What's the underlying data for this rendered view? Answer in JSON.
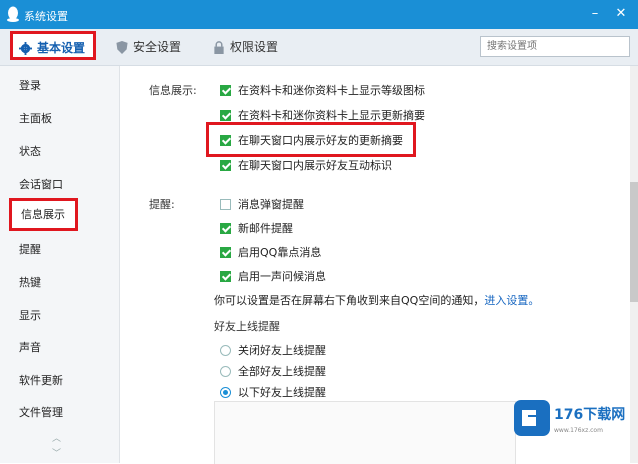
{
  "window": {
    "title": "系统设置",
    "minimize": "–",
    "close": "✕"
  },
  "tabs": [
    {
      "label": "基本设置",
      "icon": "gear-icon",
      "active": true
    },
    {
      "label": "安全设置",
      "icon": "shield-icon",
      "active": false
    },
    {
      "label": "权限设置",
      "icon": "lock-icon",
      "active": false
    }
  ],
  "search": {
    "placeholder": "搜索设置项"
  },
  "sidebar": {
    "items": [
      {
        "label": "登录"
      },
      {
        "label": "主面板"
      },
      {
        "label": "状态"
      },
      {
        "label": "会话窗口"
      },
      {
        "label": "信息展示",
        "active": true
      },
      {
        "label": "提醒"
      },
      {
        "label": "热键"
      },
      {
        "label": "显示"
      },
      {
        "label": "声音"
      },
      {
        "label": "软件更新"
      },
      {
        "label": "文件管理"
      }
    ]
  },
  "info_display": {
    "label": "信息展示:",
    "options": [
      {
        "label": "在资料卡和迷你资料卡上显示等级图标",
        "checked": true
      },
      {
        "label": "在资料卡和迷你资料卡上显示更新摘要",
        "checked": true
      },
      {
        "label": "在聊天窗口内展示好友的更新摘要",
        "checked": true
      },
      {
        "label": "在聊天窗口内展示好友互动标识",
        "checked": true
      }
    ]
  },
  "reminders": {
    "label": "提醒:",
    "options": [
      {
        "label": "消息弹窗提醒",
        "checked": false
      },
      {
        "label": "新邮件提醒",
        "checked": true
      },
      {
        "label": "启用QQ靠点消息",
        "checked": true
      },
      {
        "label": "启用一声问候消息",
        "checked": true
      }
    ],
    "note": "你可以设置是否在屏幕右下角收到来自QQ空间的通知，",
    "note_link": "进入设置。"
  },
  "friend_online": {
    "label": "好友上线提醒",
    "options": [
      {
        "label": "关闭好友上线提醒",
        "selected": false
      },
      {
        "label": "全部好友上线提醒",
        "selected": false
      },
      {
        "label": "以下好友上线提醒",
        "selected": true
      }
    ]
  },
  "watermark": {
    "brand": "176下载网",
    "url": "www.176xz.com"
  },
  "colors": {
    "titlebar": "#1a8fd6",
    "highlight": "#e0171f",
    "check": "#29a843",
    "link": "#1565c0"
  }
}
